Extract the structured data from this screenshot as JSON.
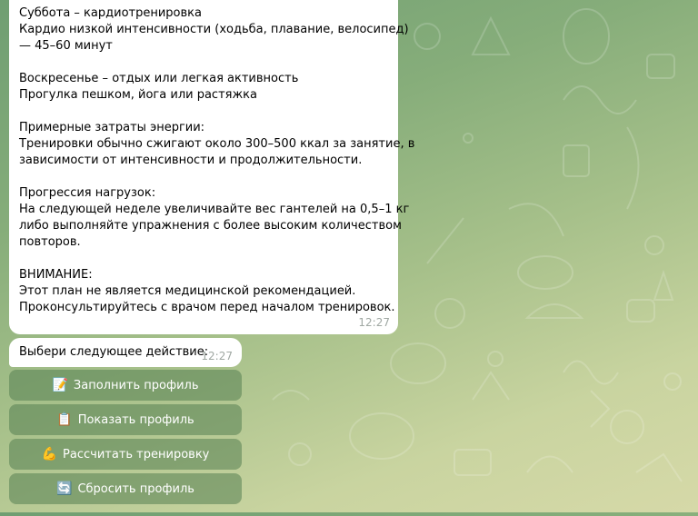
{
  "message_main": {
    "lines": [
      "Суббота – кардиотренировка",
      "Кардио низкой интенсивности (ходьба, плавание, велосипед)",
      "— 45–60 минут",
      "",
      "Воскресенье – отдых или легкая активность",
      "Прогулка пешком, йога или растяжка",
      "",
      "Примерные затраты энергии:",
      "Тренировки обычно сжигают около 300–500 ккал за занятие, в",
      "зависимости от интенсивности и продолжительности.",
      "",
      "Прогрессия нагрузок:",
      "На следующей неделе увеличивайте вес гантелей на 0,5–1 кг",
      "либо выполняйте упражнения с более высоким количеством",
      "повторов.",
      "",
      "ВНИМАНИЕ:",
      "Этот план не является медицинской рекомендацией.",
      "Проконсультируйтесь с врачом перед началом тренировок."
    ],
    "time": "12:27"
  },
  "message_prompt": {
    "text": "Выбери следующее действие:",
    "time": "12:27"
  },
  "keyboard": {
    "buttons": [
      {
        "emoji": "📝",
        "label": "Заполнить профиль"
      },
      {
        "emoji": "📋",
        "label": "Показать профиль"
      },
      {
        "emoji": "💪",
        "label": "Рассчитать тренировку"
      },
      {
        "emoji": "🔄",
        "label": "Сбросить профиль"
      }
    ]
  },
  "colors": {
    "bubble": "#ffffff",
    "timestamp": "#a0a8a3",
    "button_bg": "rgba(86,128,82,0.55)",
    "background_top": "#6f9e72",
    "background_bottom": "#d6d9a8"
  }
}
